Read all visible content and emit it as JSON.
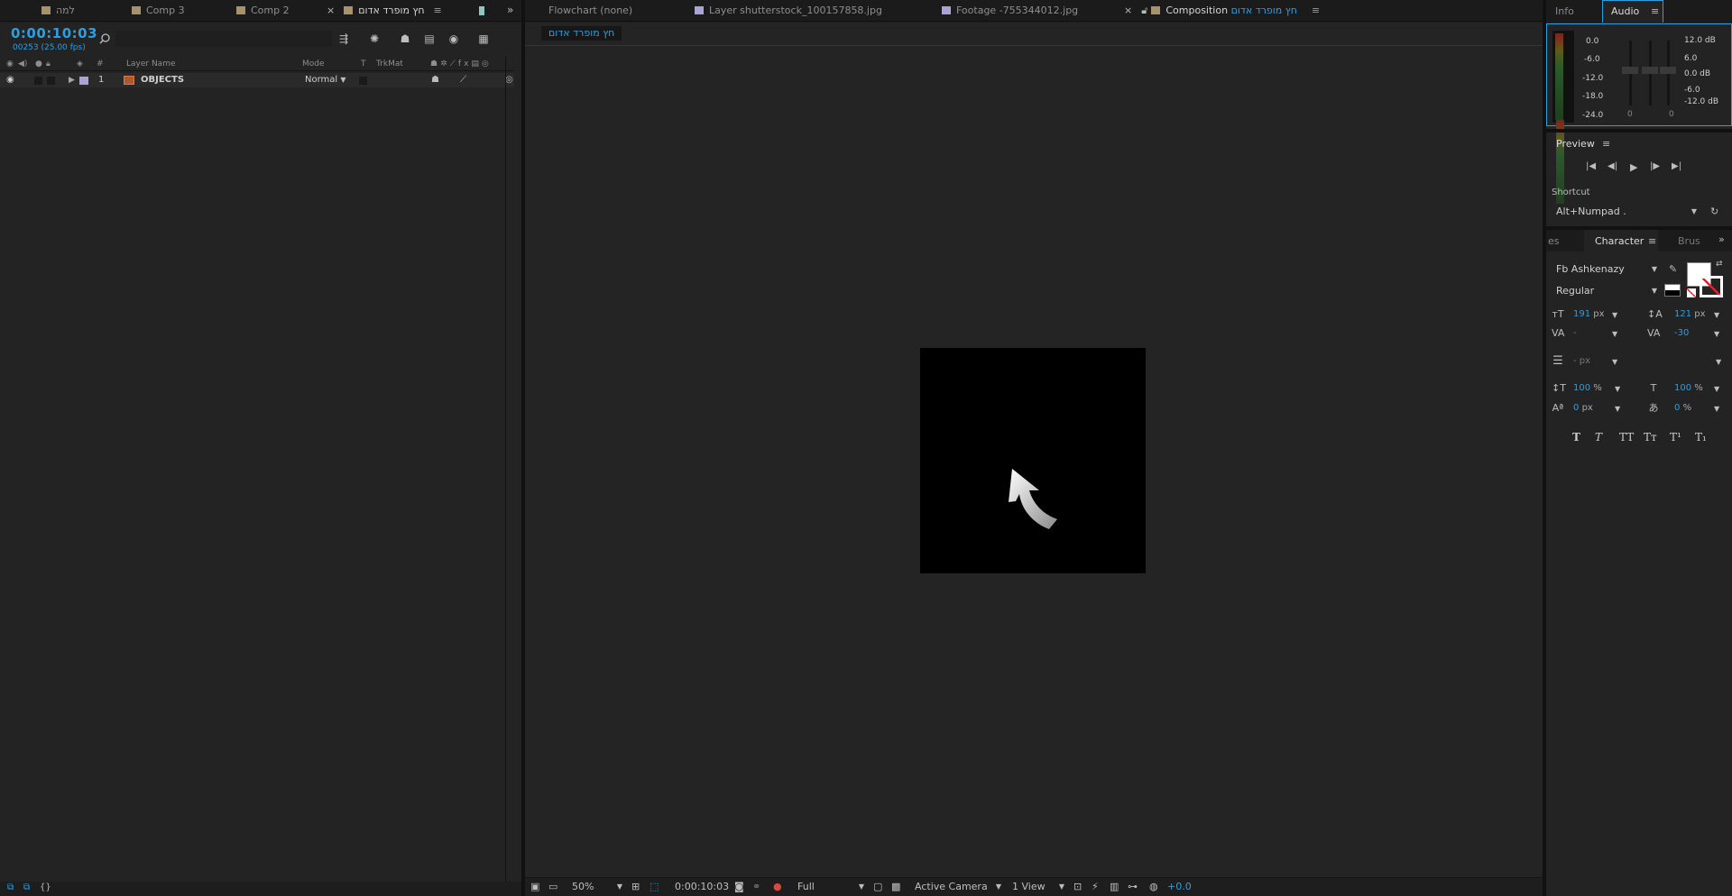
{
  "colors": {
    "accent": "#2d9ee0",
    "panel_bg": "#232323",
    "tab_bg": "#1b1b1b",
    "swatch_tan": "#a8926a",
    "swatch_lavender": "#a9a4d6",
    "swatch_teal": "#8fc7c2"
  },
  "timeline_tabs": [
    {
      "label": "למה",
      "swatch": "tan"
    },
    {
      "label": "Comp 3",
      "swatch": "tan"
    },
    {
      "label": "Comp 2",
      "swatch": "tan"
    },
    {
      "label": "חץ מופרד אדום",
      "swatch": "tan"
    }
  ],
  "timeline": {
    "timecode": "0:00:10:03",
    "frames": "00253 (25.00 fps)",
    "search_icon": "search-icon",
    "columns": {
      "layer_name": "Layer Name",
      "mode": "Mode",
      "t": "T",
      "trkmat": "TrkMat",
      "number": "#"
    },
    "layers": [
      {
        "index": "1",
        "name": "OBJECTS",
        "mode": "Normal"
      }
    ]
  },
  "viewer_tabs": [
    {
      "label": "Flowchart (none)"
    },
    {
      "label": "Layer shutterstock_100157858.jpg"
    },
    {
      "label": "Footage -755344012.jpg"
    },
    {
      "prefix": "Composition",
      "label": "חץ מופרד אדום"
    }
  ],
  "viewer": {
    "breadcrumb": "חץ מופרד אדום",
    "zoom": "50%",
    "timecode": "0:00:10:03",
    "resolution": "Full",
    "camera": "Active Camera",
    "views": "1 View",
    "exposure": "+0.0"
  },
  "right_tabs": {
    "info": "Info",
    "audio": "Audio"
  },
  "audio": {
    "left_scale": [
      "0.0",
      "-6.0",
      "-12.0",
      "-18.0",
      "-24.0"
    ],
    "right_scale": [
      "12.0 dB",
      "6.0",
      "0.0 dB",
      "-6.0",
      "-12.0 dB"
    ],
    "slider_labels": [
      "0",
      "0"
    ]
  },
  "preview": {
    "title": "Preview",
    "shortcut_label": "Shortcut",
    "shortcut_value": "Alt+Numpad ."
  },
  "character_tabs": {
    "prev": "es",
    "active": "Character",
    "next": "Brus"
  },
  "character": {
    "font_family": "Fb Ashkenazy",
    "font_style": "Regular",
    "font_size": "191",
    "font_size_unit": "px",
    "leading": "121",
    "leading_unit": "px",
    "kerning": "-",
    "tracking": "-30",
    "stroke_width": "- px",
    "vert_scale": "100",
    "vert_scale_unit": "%",
    "horiz_scale": "100",
    "horiz_scale_unit": "%",
    "baseline": "0",
    "baseline_unit": "px",
    "tsume": "0",
    "tsume_unit": "%",
    "style_buttons": [
      "T",
      "T",
      "TT",
      "Tт",
      "T¹",
      "T₁"
    ]
  }
}
